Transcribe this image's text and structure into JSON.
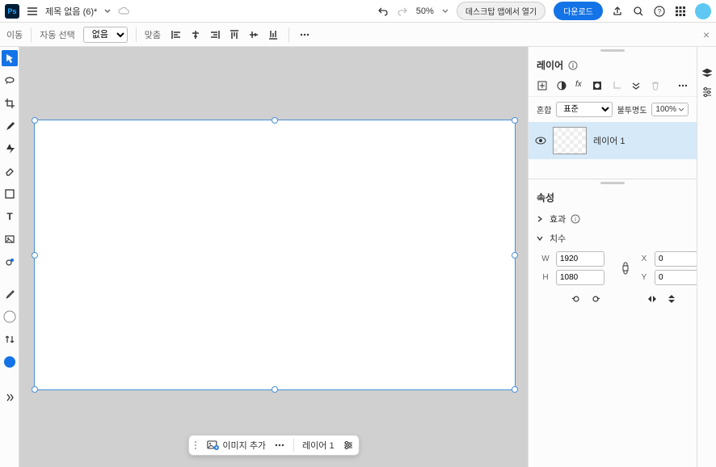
{
  "topbar": {
    "title": "제목 없음 (6)*",
    "zoom": "50%",
    "desktop_app": "데스크탑 앱에서 열기",
    "download": "다운로드"
  },
  "optbar": {
    "move_label": "이동",
    "auto_select": "자동 선택",
    "auto_select_value": "없음",
    "align_label": "맞춤"
  },
  "layers_panel": {
    "title": "레이어",
    "blend_label": "혼합",
    "blend_value": "표준",
    "opacity_label": "불투명도",
    "opacity_value": "100%"
  },
  "layer": {
    "name": "레이어 1"
  },
  "props_panel": {
    "title": "속성",
    "effects": "효과",
    "dimensions": "치수",
    "w_label": "W",
    "h_label": "H",
    "x_label": "X",
    "y_label": "Y",
    "w": "1920",
    "h": "1080",
    "x": "0",
    "y": "0"
  },
  "floating": {
    "add_image": "이미지 추가",
    "layer_name": "레이어 1"
  }
}
